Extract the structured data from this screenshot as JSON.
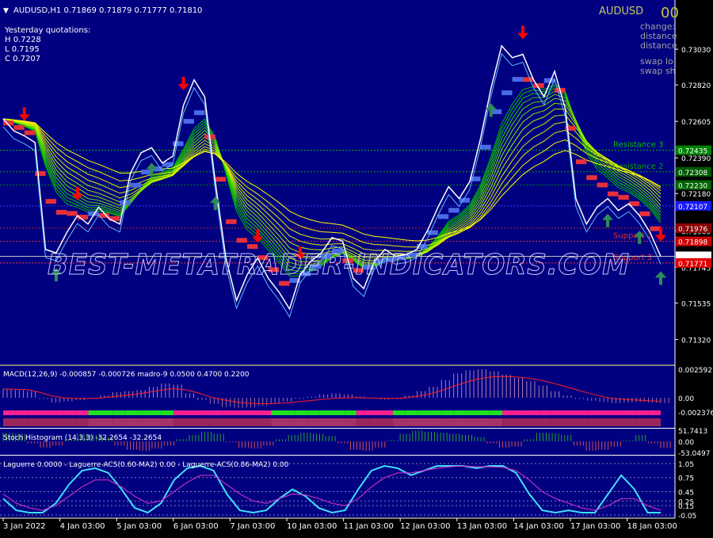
{
  "header": {
    "symbol_line": "AUDUSD,H1  0.71869 0.71879 0.71777 0.71810",
    "symbol_big": "AUDUSD",
    "corner_value": "00",
    "yesterday": [
      "Yesterday quotations:",
      "H 0.7228",
      "L 0.7195",
      "C 0.7207"
    ],
    "info_lines": [
      "change:",
      "distance",
      "distance",
      "swap lo",
      "swap sh"
    ],
    "watermark": "BEST-METATRADER-INDICATORS.COM"
  },
  "colors": {
    "background": "#000080",
    "frame": "#ffffff",
    "bull_arrow": "#2e8b57",
    "bear_arrow": "#ff0000",
    "price_line": "#ffffff",
    "step_red": "#e8303a",
    "step_blue": "#4a6ae8",
    "grid": "#2b2b95"
  },
  "chart_data": [
    {
      "name": "main",
      "type": "line",
      "title": "AUDUSD,H1",
      "ylim": [
        0.7121,
        0.7318
      ],
      "y_ticks": [
        "0.73030",
        "0.72820",
        "0.72605",
        "0.72390",
        "0.72180",
        "0.71960",
        "0.71745",
        "0.71535",
        "0.71320"
      ],
      "x_ticks": [
        "3 Jan 2022",
        "4 Jan 03:00",
        "5 Jan 03:00",
        "6 Jan 03:00",
        "7 Jan 03:00",
        "10 Jan 03:00",
        "11 Jan 03:00",
        "12 Jan 03:00",
        "13 Jan 03:00",
        "14 Jan 03:00",
        "17 Jan 03:00",
        "18 Jan 03:00"
      ],
      "price": [
        0.7262,
        0.7255,
        0.7252,
        0.7248,
        0.7185,
        0.7183,
        0.7195,
        0.7205,
        0.72,
        0.721,
        0.7203,
        0.72,
        0.723,
        0.7242,
        0.7245,
        0.7236,
        0.724,
        0.727,
        0.7285,
        0.7275,
        0.7225,
        0.718,
        0.7155,
        0.717,
        0.718,
        0.7168,
        0.716,
        0.715,
        0.717,
        0.7178,
        0.7183,
        0.7192,
        0.719,
        0.7168,
        0.7162,
        0.7178,
        0.7185,
        0.7181,
        0.7182,
        0.7185,
        0.7196,
        0.721,
        0.7222,
        0.7215,
        0.7225,
        0.725,
        0.728,
        0.7305,
        0.7298,
        0.73,
        0.7285,
        0.7275,
        0.729,
        0.7268,
        0.7215,
        0.72,
        0.721,
        0.7215,
        0.7208,
        0.7212,
        0.7205,
        0.7195,
        0.7181
      ],
      "price_labels": [
        {
          "text": "0.72435",
          "value": 0.72435,
          "color": "#008000"
        },
        {
          "text": "0.72308",
          "value": 0.72308,
          "color": "#005a00"
        },
        {
          "text": "0.72230",
          "value": 0.7223,
          "color": "#006400"
        },
        {
          "text": "0.72107",
          "value": 0.72107,
          "color": "#1a1aff"
        },
        {
          "text": "0.71976",
          "value": 0.71976,
          "color": "#8b0000"
        },
        {
          "text": "0.71898",
          "value": 0.71898,
          "color": "#cc0000"
        },
        {
          "text": "0.71810",
          "value": 0.7181,
          "color": "#ffffff"
        },
        {
          "text": "0.71771",
          "value": 0.71771,
          "color": "#e00000"
        }
      ],
      "levels": [
        {
          "name": "Resistance 3",
          "value": 0.72435,
          "color": "#00c000"
        },
        {
          "name": "Resistance 2",
          "value": 0.72308,
          "color": "#00a000"
        },
        {
          "name": "",
          "value": 0.7223,
          "color": "#008000"
        },
        {
          "name": "",
          "value": 0.72107,
          "color": "#3a3aff"
        },
        {
          "name": "",
          "value": 0.71976,
          "color": "#c02020"
        },
        {
          "name": "Support 2",
          "value": 0.71898,
          "color": "#e03030"
        },
        {
          "name": "Support 3",
          "value": 0.71771,
          "color": "#ff3030"
        }
      ],
      "bear_arrows": [
        2,
        7,
        17,
        24,
        28,
        49,
        62,
        73,
        82,
        86,
        87
      ],
      "bull_arrows": [
        5,
        14,
        20,
        46,
        67,
        57,
        60,
        63,
        69,
        72,
        78,
        80
      ]
    },
    {
      "name": "macd",
      "type": "bar",
      "title": "MACD(12,26,9) -0.000857 -0.000726  madro-9 0.0500 0.4700 0.2200",
      "y_ticks": [
        "0.002592",
        "0.00",
        "-0.002376"
      ],
      "values": [
        0.0008,
        0.0007,
        0.0006,
        -0.0002,
        -0.0008,
        -0.0006,
        -0.0004,
        -0.0002,
        0.0002,
        0.0005,
        0.0006,
        0.0007,
        0.001,
        0.0013,
        0.0012,
        0.0004,
        -0.0004,
        -0.001,
        -0.0015,
        -0.0017,
        -0.0016,
        -0.0013,
        -0.001,
        -0.0006,
        -0.0002,
        0.0001,
        0.0003,
        0.0004,
        0.0003,
        0.0001,
        -0.0001,
        -0.0003,
        -0.0002,
        0.0002,
        0.0006,
        0.001,
        0.0016,
        0.0022,
        0.0025,
        0.0026,
        0.0024,
        0.0021,
        0.0018,
        0.0015,
        0.0011,
        0.0006,
        0.0002,
        -0.0002,
        -0.0005,
        -0.0007,
        -0.0009,
        -0.0008,
        -0.0007,
        -0.0008,
        -0.0009
      ]
    },
    {
      "name": "stoch",
      "type": "bar",
      "title": "Stoch Histogram (14,3,3) -32.2654 -32.2654",
      "y_ticks": [
        "51.7413",
        "0.00",
        "-53.0497"
      ],
      "values": [
        40,
        35,
        -10,
        -30,
        -20,
        10,
        35,
        30,
        20,
        -20,
        -40,
        -45,
        -35,
        -20,
        10,
        30,
        45,
        35,
        -5,
        -30,
        -35,
        -20,
        10,
        30,
        40,
        35,
        25,
        -10,
        -40,
        -45,
        -30,
        5,
        35,
        50,
        45,
        40,
        35,
        30,
        20,
        -10,
        -30,
        -25,
        10,
        40,
        38,
        30,
        -20,
        -45,
        -40,
        -25,
        5,
        30,
        -10,
        -32
      ]
    },
    {
      "name": "laguerre",
      "type": "line",
      "title": "Laguerre 0.0000 - Laguerre-ACS(0.60-MA2) 0.00 - Laguerre-ACS(0.86-MA2) 0.00",
      "y_ticks": [
        "1.05",
        "0.75",
        "0.45",
        "0.25",
        "0.15",
        "-0.05"
      ],
      "ylim": [
        -0.05,
        1.05
      ],
      "series": [
        {
          "values": [
            0.3,
            0.05,
            0.0,
            0.0,
            0.2,
            0.6,
            0.9,
            0.95,
            0.85,
            0.5,
            0.1,
            0.0,
            0.2,
            0.7,
            0.95,
            1.0,
            0.9,
            0.4,
            0.05,
            0.0,
            0.05,
            0.3,
            0.5,
            0.35,
            0.1,
            0.0,
            0.05,
            0.5,
            0.9,
            1.0,
            0.95,
            0.8,
            0.9,
            1.0,
            1.0,
            1.0,
            0.95,
            1.0,
            1.0,
            0.85,
            0.4,
            0.05,
            0.0,
            0.05,
            0.0,
            0.0,
            0.4,
            0.8,
            0.5,
            0.0,
            0.0
          ]
        },
        {
          "values": [
            0.4,
            0.2,
            0.1,
            0.05,
            0.15,
            0.35,
            0.55,
            0.7,
            0.7,
            0.55,
            0.35,
            0.2,
            0.25,
            0.45,
            0.65,
            0.8,
            0.8,
            0.6,
            0.4,
            0.25,
            0.2,
            0.3,
            0.4,
            0.38,
            0.3,
            0.2,
            0.15,
            0.3,
            0.55,
            0.75,
            0.85,
            0.85,
            0.9,
            0.95,
            0.98,
            1.0,
            0.98,
            0.98,
            0.97,
            0.9,
            0.7,
            0.45,
            0.3,
            0.2,
            0.1,
            0.05,
            0.15,
            0.3,
            0.3,
            0.15,
            0.05
          ]
        }
      ]
    }
  ]
}
